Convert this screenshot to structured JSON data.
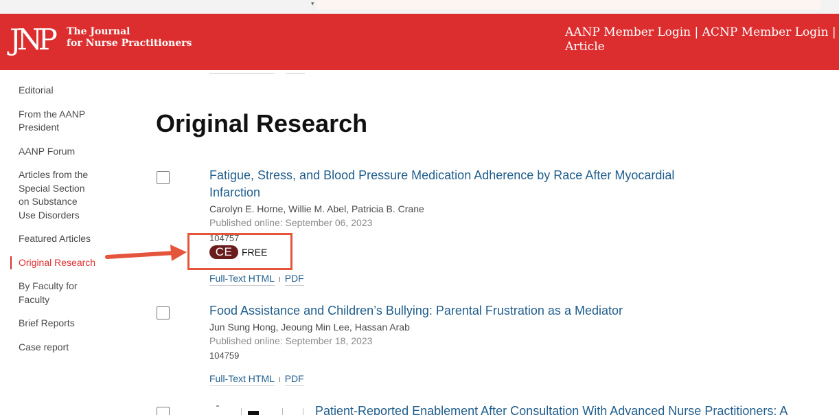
{
  "header": {
    "logo_mark": "JNP",
    "logo_line1": "The Journal",
    "logo_line2": "for Nurse Practitioners",
    "links_line1": "AANP Member Login | ACNP Member Login | Su",
    "links_line2": "Article"
  },
  "sidebar": {
    "items": [
      {
        "label": "Editorial"
      },
      {
        "label": "From the AANP President"
      },
      {
        "label": "AANP Forum"
      },
      {
        "label": "Articles from the Special Section on Substance Use Disorders"
      },
      {
        "label": "Featured Articles"
      },
      {
        "label": "Original Research"
      },
      {
        "label": "By Faculty for Faculty"
      },
      {
        "label": "Brief Reports"
      },
      {
        "label": "Case report"
      }
    ],
    "active_index": 5
  },
  "main": {
    "section_title": "Original Research",
    "articles": [
      {
        "title": "Fatigue, Stress, and Blood Pressure Medication Adherence by Race After Myocardial Infarction",
        "authors": "Carolyn E. Horne, Willie M. Abel, Patricia B. Crane",
        "date": "Published online: September 06, 2023",
        "id": "104757",
        "ce_label": "CE",
        "free_label": "FREE",
        "link_html": "Full-Text HTML",
        "link_pdf": "PDF",
        "link_sep": "I"
      },
      {
        "title": "Food Assistance and Children’s Bullying: Parental Frustration as a Mediator",
        "authors": "Jun Sung Hong, Jeoung Min Lee, Hassan Arab",
        "date": "Published online: September 18, 2023",
        "id": "104759",
        "link_html": "Full-Text HTML",
        "link_pdf": "PDF",
        "link_sep": "I"
      },
      {
        "title": "Patient-Reported Enablement After Consultation With Advanced Nurse Practitioners: A"
      }
    ]
  },
  "colors": {
    "brand_red": "#dd2e2f",
    "link_blue": "#1f5d8c",
    "ce_badge": "#6b1c1c",
    "annotation": "#e4553c"
  }
}
